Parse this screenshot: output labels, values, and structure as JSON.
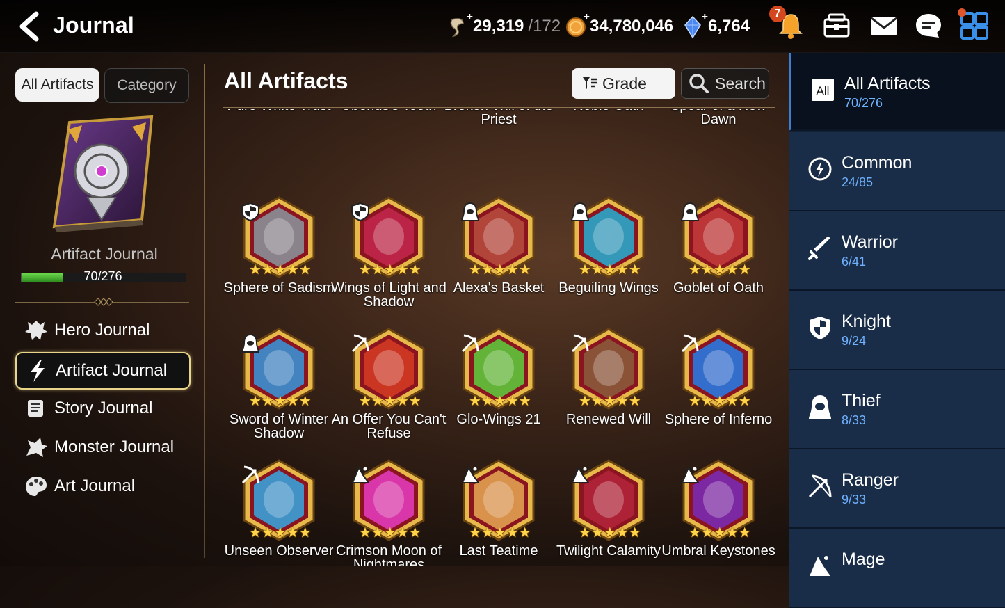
{
  "topbar": {
    "title": "Journal",
    "stamina": "29,319",
    "stamina_max": "/172",
    "gold": "34,780,046",
    "crystals": "6,764",
    "notification_count": "7"
  },
  "left": {
    "tabs": [
      "All Artifacts",
      "Category"
    ],
    "journal_name": "Artifact Journal",
    "progress_text": "70/276",
    "progress_fraction": 0.2536,
    "nav": [
      {
        "label": "Hero Journal",
        "icon": "hero-icon"
      },
      {
        "label": "Artifact Journal",
        "icon": "lightning-icon"
      },
      {
        "label": "Story Journal",
        "icon": "scroll-icon"
      },
      {
        "label": "Monster Journal",
        "icon": "monster-icon"
      },
      {
        "label": "Art Journal",
        "icon": "palette-icon"
      }
    ]
  },
  "center": {
    "title": "All Artifacts",
    "grade_label": "Grade",
    "search_label": "Search",
    "rows": [
      [
        {
          "name": "Pure White Trust",
          "color": "#d8b88a"
        },
        {
          "name": "Uberius's Tooth",
          "color": "#5b8fb0"
        },
        {
          "name": "Broken Will of the Priest",
          "color": "#46c7b7"
        },
        {
          "name": "Noble Oath",
          "color": "#b23b46"
        },
        {
          "name": "Spear of a New Dawn",
          "color": "#55c9d6"
        }
      ],
      [
        {
          "name": "Sphere of Sadism",
          "color": "#8b8f98",
          "cls": "knight"
        },
        {
          "name": "Wings of Light and Shadow",
          "color": "#c0264a",
          "cls": "knight"
        },
        {
          "name": "Alexa's Basket",
          "color": "#b64a3c",
          "cls": "thief"
        },
        {
          "name": "Beguiling Wings",
          "color": "#2aa7c9",
          "cls": "thief"
        },
        {
          "name": "Goblet of Oath",
          "color": "#c23a3a",
          "cls": "thief"
        }
      ],
      [
        {
          "name": "Sword of Winter Shadow",
          "color": "#3a8fd1",
          "cls": "thief"
        },
        {
          "name": "An Offer You Can't Refuse",
          "color": "#d23a23",
          "cls": "ranger"
        },
        {
          "name": "Glo-Wings 21",
          "color": "#5ec43c",
          "cls": "ranger"
        },
        {
          "name": "Renewed Will",
          "color": "#8a5a3a",
          "cls": "ranger"
        },
        {
          "name": "Sphere of Inferno",
          "color": "#2a78e0",
          "cls": "ranger"
        }
      ],
      [
        {
          "name": "Unseen Observer",
          "color": "#3aa0d8",
          "cls": "ranger"
        },
        {
          "name": "Crimson Moon of Nightmares",
          "color": "#e03ab8",
          "cls": "mage"
        },
        {
          "name": "Last Teatime",
          "color": "#e0a050",
          "cls": "mage"
        },
        {
          "name": "Twilight Calamity",
          "color": "#b0243a",
          "cls": "mage"
        },
        {
          "name": "Umbral Keystones",
          "color": "#7a2ab0",
          "cls": "mage"
        }
      ]
    ]
  },
  "right": {
    "categories": [
      {
        "name": "All Artifacts",
        "count": "70/276",
        "icon": "all-icon"
      },
      {
        "name": "Common",
        "count": "24/85",
        "icon": "common-icon"
      },
      {
        "name": "Warrior",
        "count": "6/41",
        "icon": "warrior-icon"
      },
      {
        "name": "Knight",
        "count": "9/24",
        "icon": "knight-icon"
      },
      {
        "name": "Thief",
        "count": "8/33",
        "icon": "thief-icon"
      },
      {
        "name": "Ranger",
        "count": "9/33",
        "icon": "ranger-icon"
      },
      {
        "name": "Mage",
        "count": "",
        "icon": "mage-icon"
      }
    ],
    "all_glyph": "All"
  }
}
